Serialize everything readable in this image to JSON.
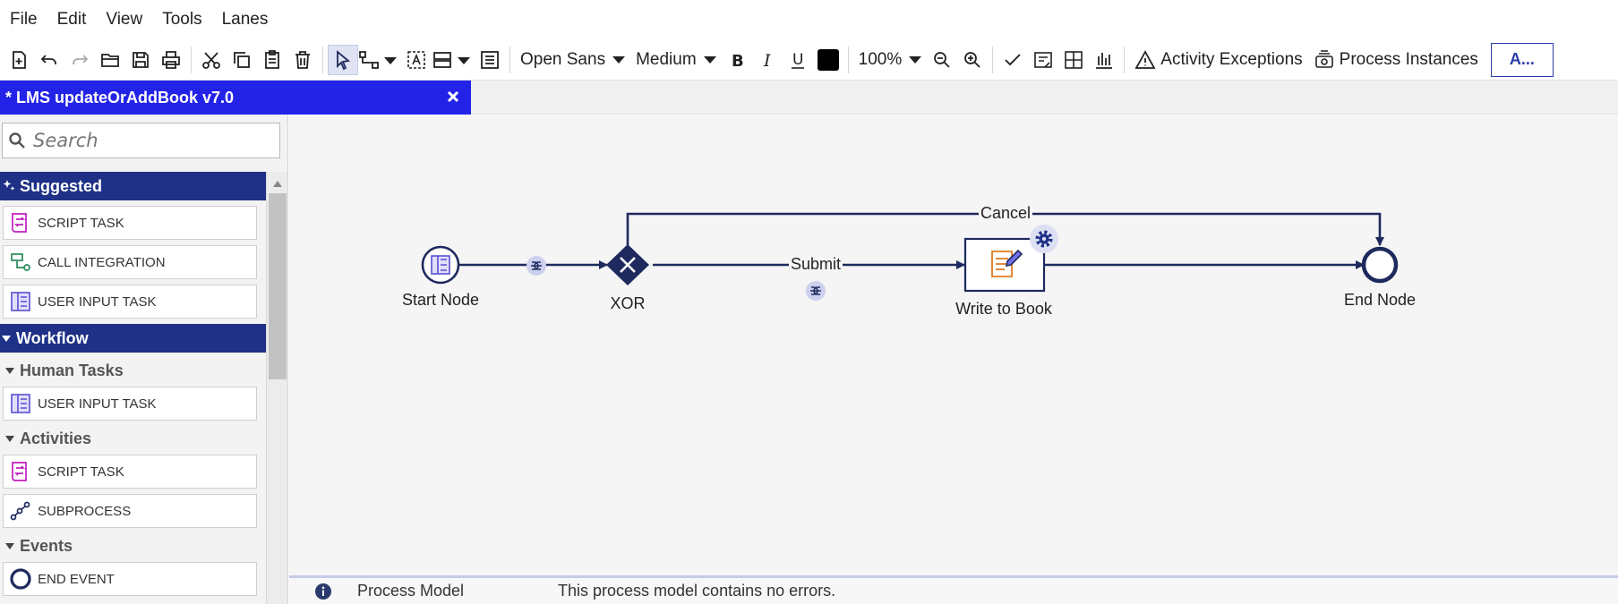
{
  "menu": [
    "File",
    "Edit",
    "View",
    "Tools",
    "Lanes"
  ],
  "toolbar": {
    "font_family": "Open Sans",
    "font_size": "Medium",
    "zoom": "100%",
    "activity_exceptions": "Activity Exceptions",
    "process_instances": "Process Instances",
    "user_initials": "A...",
    "text_color": "#000000",
    "icons": [
      "new-file-icon",
      "undo-icon",
      "redo-icon",
      "open-icon",
      "save-icon",
      "print-icon",
      "cut-icon",
      "copy-icon",
      "paste-icon",
      "delete-icon",
      "select-pointer-icon",
      "connector-icon",
      "text-box-icon",
      "layout-icon",
      "list-icon",
      "bold-icon",
      "italic-icon",
      "underline-icon",
      "zoom-out-icon",
      "zoom-in-icon",
      "check-icon",
      "notes-icon",
      "grid-icon",
      "chart-icon",
      "warning-icon",
      "process-instances-icon"
    ]
  },
  "tab": {
    "title": "* LMS updateOrAddBook v7.0"
  },
  "sidebar": {
    "search_placeholder": "Search",
    "sections": {
      "suggested": {
        "title": "Suggested",
        "items": [
          "SCRIPT TASK",
          "CALL INTEGRATION",
          "USER INPUT TASK"
        ]
      },
      "workflow": {
        "title": "Workflow",
        "human_tasks": {
          "title": "Human Tasks",
          "items": [
            "USER INPUT TASK"
          ]
        },
        "activities": {
          "title": "Activities",
          "items": [
            "SCRIPT TASK",
            "SUBPROCESS"
          ]
        },
        "events": {
          "title": "Events",
          "items": [
            "END EVENT"
          ]
        }
      }
    }
  },
  "diagram": {
    "nodes": {
      "start": "Start Node",
      "xor": "XOR",
      "write": "Write to Book",
      "end": "End Node"
    },
    "flows": {
      "submit": "Submit",
      "cancel": "Cancel"
    }
  },
  "status": {
    "label": "Process Model",
    "message": "This process model contains no errors."
  },
  "colors": {
    "tab": "#2323e8",
    "section": "#1e3187",
    "node": "#1e2a5e",
    "accent_orange": "#e07b22",
    "accent_magenta": "#c01fbf"
  }
}
